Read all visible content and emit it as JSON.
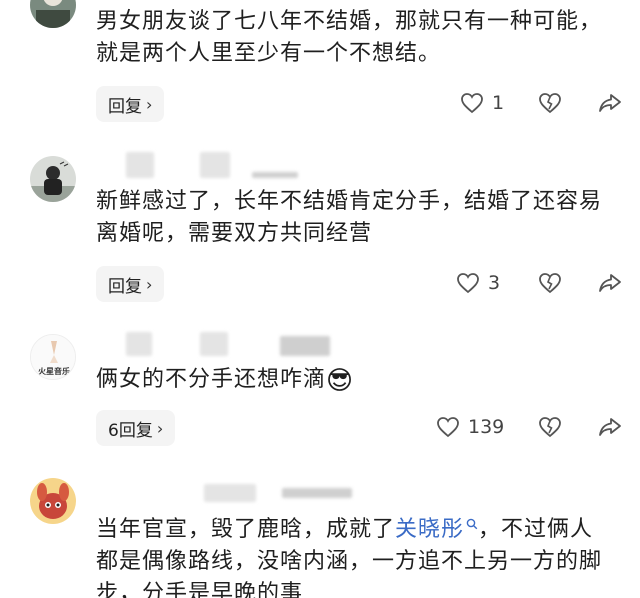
{
  "comments": [
    {
      "text": "男女朋友谈了七八年不结婚，那就只有一种可能，就是两个人里至少有一个不想结。",
      "reply_label": "回复",
      "like_count": "1"
    },
    {
      "text": "新鲜感过了，长年不结婚肯定分手，结婚了还容易离婚呢，需要双方共同经营",
      "reply_label": "回复",
      "like_count": "3"
    },
    {
      "avatar_text": "火星音乐",
      "text": "俩女的不分手还想咋滴",
      "emoji": "😎",
      "reply_label": "6回复",
      "like_count": "139"
    },
    {
      "text_before": "当年官宣，毁了鹿晗，成就了",
      "mention": "关晓彤",
      "text_after": "，不过俩人都是偶像路线，没啥内涵，一方追不上另一方的脚步，分手是早晚的事"
    }
  ],
  "colors": {
    "mention": "#3a6bc6",
    "reply_bg": "#f4f4f4"
  },
  "icons": [
    "heart-icon",
    "broken-heart-icon",
    "share-icon",
    "chevron-right-icon",
    "search-icon"
  ]
}
